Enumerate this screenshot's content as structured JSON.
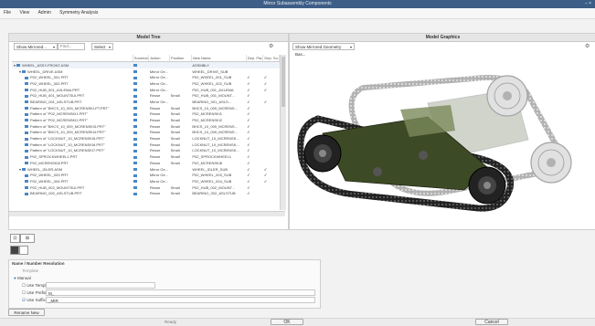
{
  "window": {
    "title": "Mirror Subassembly Components",
    "controls": "– ×"
  },
  "menu": {
    "items": [
      "File",
      "View",
      "Admin",
      "Symmetry Analysis"
    ]
  },
  "model_tree": {
    "title": "Model Tree",
    "filter_combo": "Show Mirrored...",
    "find_placeholder": "Find...",
    "select_combo": "Select",
    "columns": [
      "",
      "Summar...",
      "Action",
      "Position",
      "New Name",
      "Dep. Pla...",
      "Dep. Su..."
    ],
    "rows": [
      {
        "name": "WHEEL_ASSY-FRONT.ASM",
        "sum": "",
        "action": "",
        "pos": "",
        "newname": "ASSMBLY",
        "dp": "",
        "ds": "",
        "indent": 0
      },
      {
        "name": "WHEEL_DRIVE.ASM",
        "sum": "",
        "action": "Mirror Ge...",
        "pos": "",
        "newname": "WHEEL_DRIVE_SUB",
        "dp": "",
        "ds": "",
        "indent": 1
      },
      {
        "name": "P02_WHEEL_001.PRT",
        "sum": "",
        "action": "Mirror Ge...",
        "pos": "",
        "newname": "P02_WHEEL_001_SUB",
        "dp": "✓",
        "ds": "✓",
        "indent": 2
      },
      {
        "name": "P02_WHEEL_002.PRT",
        "sum": "",
        "action": "Mirror Ge...",
        "pos": "",
        "newname": "P02_WHEEL_002_SUB",
        "dp": "✓",
        "ds": "✓",
        "indent": 2
      },
      {
        "name": "P02_HUB_001_AXLEMA.PRT",
        "sum": "",
        "action": "Mirror Ge...",
        "pos": "",
        "newname": "P02_HUB_001_AXLEMA",
        "dp": "✓",
        "ds": "✓",
        "indent": 2
      },
      {
        "name": "P02_HUB_001_MOUNTSUI.PRT",
        "sum": "",
        "action": "Reuse",
        "pos": "Small",
        "newname": "P02_HUB_001_MOUNT...",
        "dp": "✓",
        "ds": "",
        "indent": 2
      },
      {
        "name": "BEARING_001_ASLSTUB.PRT",
        "sum": "",
        "action": "Mirror Ge...",
        "pos": "",
        "newname": "BEARING_001_ASLS...",
        "dp": "✓",
        "ds": "✓",
        "indent": 2
      },
      {
        "name": "Pattern of \"BHCS_10_009_MCRENSKI-PT.PRT\"",
        "sum": "",
        "action": "Reuse",
        "pos": "Small",
        "newname": "BHCS_10_009_MCRENS...",
        "dp": "✓",
        "ds": "",
        "indent": 2
      },
      {
        "name": "Pattern of \"P02_MCRENSKI1.PRT\"",
        "sum": "",
        "action": "Reuse",
        "pos": "Small",
        "newname": "P02_MCRENSKI1",
        "dp": "✓",
        "ds": "",
        "indent": 2
      },
      {
        "name": "Pattern of \"P02_MCRENSKI2.PRT\"",
        "sum": "",
        "action": "Reuse",
        "pos": "Small",
        "newname": "P02_MCRENSKI2",
        "dp": "✓",
        "ds": "",
        "indent": 2
      },
      {
        "name": "Pattern of \"BHCS_10_009_MCRENSKI3.PRT\"",
        "sum": "",
        "action": "Reuse",
        "pos": "Small",
        "newname": "BHCS_10_009_MCRENS...",
        "dp": "✓",
        "ds": "",
        "indent": 2
      },
      {
        "name": "Pattern of \"BHCS_10_009_MCRENSKI4.PRT\"",
        "sum": "",
        "action": "Reuse",
        "pos": "Small",
        "newname": "BHCS_10_009_MCRENS...",
        "dp": "✓",
        "ds": "",
        "indent": 2
      },
      {
        "name": "Pattern of \"LOCKNUT_10_MCRENSKI5.PRT\"",
        "sum": "",
        "action": "Reuse",
        "pos": "Small",
        "newname": "LOCKNUT_10_MCRENSK...",
        "dp": "✓",
        "ds": "",
        "indent": 2
      },
      {
        "name": "Pattern of \"LOCKNUT_10_MCRENSKI6.PRT\"",
        "sum": "",
        "action": "Reuse",
        "pos": "Small",
        "newname": "LOCKNUT_10_MCRENSK...",
        "dp": "✓",
        "ds": "",
        "indent": 2
      },
      {
        "name": "Pattern of \"LOCKNUT_10_MCRENSKI7.PRT\"",
        "sum": "",
        "action": "Reuse",
        "pos": "Small",
        "newname": "LOCKNUT_10_MCRENSK...",
        "dp": "✓",
        "ds": "",
        "indent": 2
      },
      {
        "name": "P02_SPROCKWHEEL1.PRT",
        "sum": "",
        "action": "Reuse",
        "pos": "Small",
        "newname": "P02_SPROCKWHEEL1",
        "dp": "✓",
        "ds": "",
        "indent": 2
      },
      {
        "name": "P02_MCRENSKI8.PRT",
        "sum": "",
        "action": "Reuse",
        "pos": "Small",
        "newname": "P02_MCRENSKI8",
        "dp": "✓",
        "ds": "",
        "indent": 2
      },
      {
        "name": "WHEEL_IDLER.ASM",
        "sum": "",
        "action": "Mirror Ge...",
        "pos": "",
        "newname": "WHEEL_IDLER_SUB",
        "dp": "✓",
        "ds": "✓",
        "indent": 1
      },
      {
        "name": "P02_WHEEL_003.PRT",
        "sum": "",
        "action": "Mirror Ge...",
        "pos": "",
        "newname": "P02_WHEEL_003_SUB",
        "dp": "✓",
        "ds": "✓",
        "indent": 2
      },
      {
        "name": "P02_WHEEL_004.PRT",
        "sum": "",
        "action": "Mirror Ge...",
        "pos": "",
        "newname": "P02_WHEEL_004_SUB",
        "dp": "✓",
        "ds": "✓",
        "indent": 2
      },
      {
        "name": "P02_HUB_002_MOUNTSUI.PRT",
        "sum": "",
        "action": "Reuse",
        "pos": "Small",
        "newname": "P02_HUB_002_MOUNT...",
        "dp": "✓",
        "ds": "",
        "indent": 2
      },
      {
        "name": "BEARING_002_ASLSTUB.PRT",
        "sum": "",
        "action": "Reuse",
        "pos": "Small",
        "newname": "BEARING_002_ASLSTUB",
        "dp": "✓",
        "ds": "",
        "indent": 2
      }
    ]
  },
  "model_graphics": {
    "title": "Model Graphics",
    "view_combo": "Show Mirrored Geometry Bas..."
  },
  "bottom": {
    "section_title": "Name / Number Resolution",
    "template_label": "Template",
    "manual_label": "Manual",
    "use_template_label": "Use Template",
    "use_prefix_label": "Use Prefix",
    "use_suffix_label": "Use Suffix",
    "prefix_value": "M_",
    "suffix_value": "_MIR",
    "rename_button": "Rename New Names"
  },
  "footer": {
    "ok_label": "OK",
    "cancel_label": "Cancel",
    "status": "Ready"
  }
}
